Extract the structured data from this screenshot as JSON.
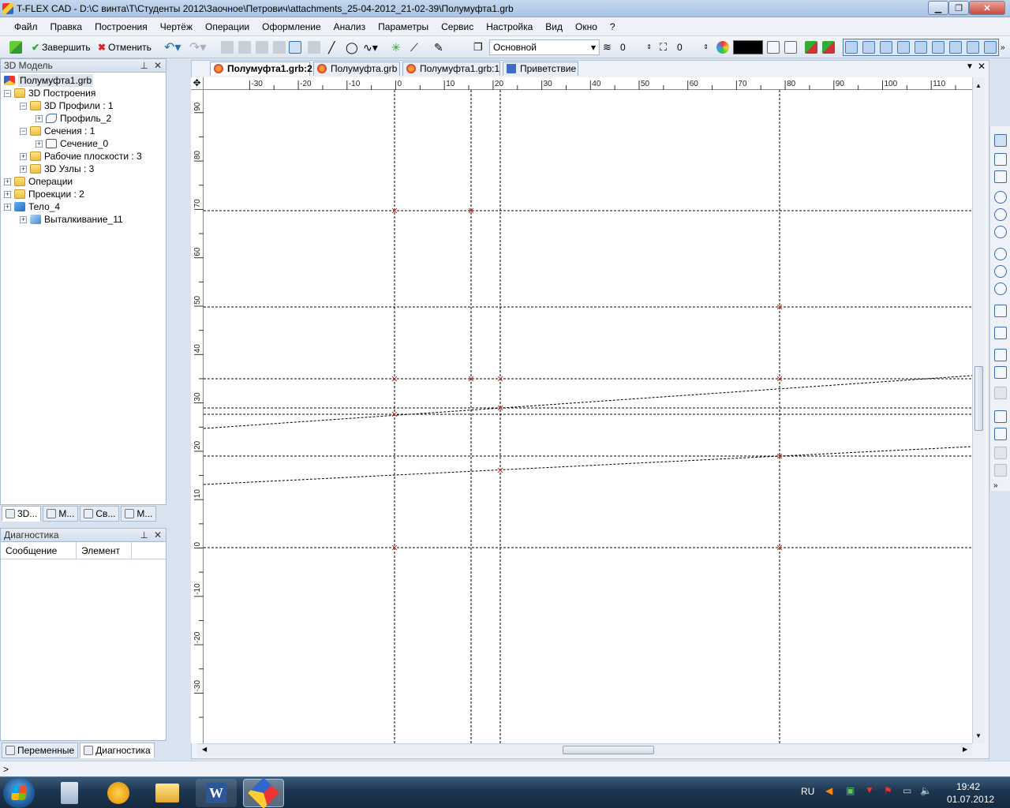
{
  "window": {
    "title": "T-FLEX CAD - D:\\С винта\\Т\\Студенты 2012\\Заочное\\Петрович\\attachments_25-04-2012_21-02-39\\Полумуфта1.grb"
  },
  "menu": [
    "Файл",
    "Правка",
    "Построения",
    "Чертёж",
    "Операции",
    "Оформление",
    "Анализ",
    "Параметры",
    "Сервис",
    "Настройка",
    "Вид",
    "Окно",
    "?"
  ],
  "toolbar": {
    "finish_label": "Завершить",
    "cancel_label": "Отменить",
    "layer_value": "Основной",
    "level_value": "0",
    "priority_value": "0",
    "color_value": "#000000"
  },
  "model_panel": {
    "title": "3D Модель",
    "tree": [
      {
        "label": "Полумуфта1.grb",
        "depth": 0,
        "icon": "document-icon"
      },
      {
        "label": "3D Построения",
        "depth": 0,
        "icon": "folder-icon",
        "toggle": "−"
      },
      {
        "label": "3D Профили : 1",
        "depth": 1,
        "icon": "folder-icon",
        "toggle": "−"
      },
      {
        "label": "Профиль_2",
        "depth": 2,
        "icon": "profile-icon",
        "toggle": "+"
      },
      {
        "label": "Сечения : 1",
        "depth": 1,
        "icon": "folder-icon",
        "toggle": "−"
      },
      {
        "label": "Сечение_0",
        "depth": 2,
        "icon": "section-icon",
        "toggle": "+"
      },
      {
        "label": "Рабочие плоскости : 3",
        "depth": 1,
        "icon": "folder-icon",
        "toggle": "+"
      },
      {
        "label": "3D Узлы : 3",
        "depth": 1,
        "icon": "folder-icon",
        "toggle": "+"
      },
      {
        "label": "Операции",
        "depth": 0,
        "icon": "folder-icon",
        "toggle": "+"
      },
      {
        "label": "Проекции : 2",
        "depth": 0,
        "icon": "folder-icon",
        "toggle": "+"
      },
      {
        "label": "Тело_4",
        "depth": 0,
        "icon": "body-icon",
        "toggle": "+"
      },
      {
        "label": "Выталкивание_11",
        "depth": 1,
        "icon": "extrude-icon",
        "toggle": "+"
      }
    ],
    "tabs": [
      "3D...",
      "М...",
      "Св...",
      "М..."
    ]
  },
  "diag_panel": {
    "title": "Диагностика",
    "col_message": "Сообщение",
    "col_element": "Элемент",
    "tabs": [
      "Переменные",
      "Диагностика"
    ]
  },
  "doc_tabs": [
    "Полумуфта1.grb:2",
    "Полумуфта.grb",
    "Полумуфта1.grb:1",
    "Приветствие"
  ],
  "ruler": {
    "h_labels": [
      "-30",
      "-20",
      "-10",
      "0",
      "10",
      "20",
      "30",
      "40",
      "50",
      "60",
      "70",
      "80",
      "90",
      "100",
      "110"
    ],
    "v_labels": [
      "90",
      "80",
      "70",
      "60",
      "50",
      "40",
      "30",
      "20",
      "10",
      "0",
      "-10",
      "-20",
      "-30"
    ]
  },
  "status_text": ">",
  "tray": {
    "lang": "RU",
    "time": "19:42",
    "date": "01.07.2012"
  }
}
